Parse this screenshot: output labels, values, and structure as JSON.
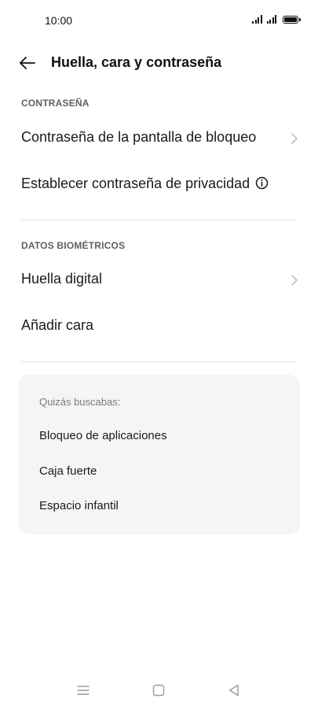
{
  "status_bar": {
    "time": "10:00"
  },
  "header": {
    "title": "Huella, cara y contraseña",
    "back_icon": "arrow-left-icon"
  },
  "sections": {
    "password": {
      "header": "CONTRASEÑA",
      "items": [
        {
          "label": "Contraseña de la pantalla de bloqueo",
          "icon": "chevron-right-icon"
        },
        {
          "label": "Establecer contraseña de privacidad",
          "icon": "info-icon"
        }
      ]
    },
    "biometrics": {
      "header": "DATOS BIOMÉTRICOS",
      "items": [
        {
          "label": "Huella digital",
          "icon": "chevron-right-icon"
        },
        {
          "label": "Añadir cara"
        }
      ]
    }
  },
  "suggestions": {
    "title": "Quizás buscabas:",
    "items": [
      "Bloqueo de aplicaciones",
      "Caja fuerte",
      "Espacio infantil"
    ]
  },
  "nav_bar": {
    "icons": [
      "menu-icon",
      "home-square-icon",
      "back-triangle-icon"
    ]
  },
  "colors": {
    "background": "#ffffff",
    "text": "#1a1a1a",
    "section_header": "#5f5f5f",
    "card_background": "#f5f5f5",
    "divider": "#e6e6e6"
  }
}
